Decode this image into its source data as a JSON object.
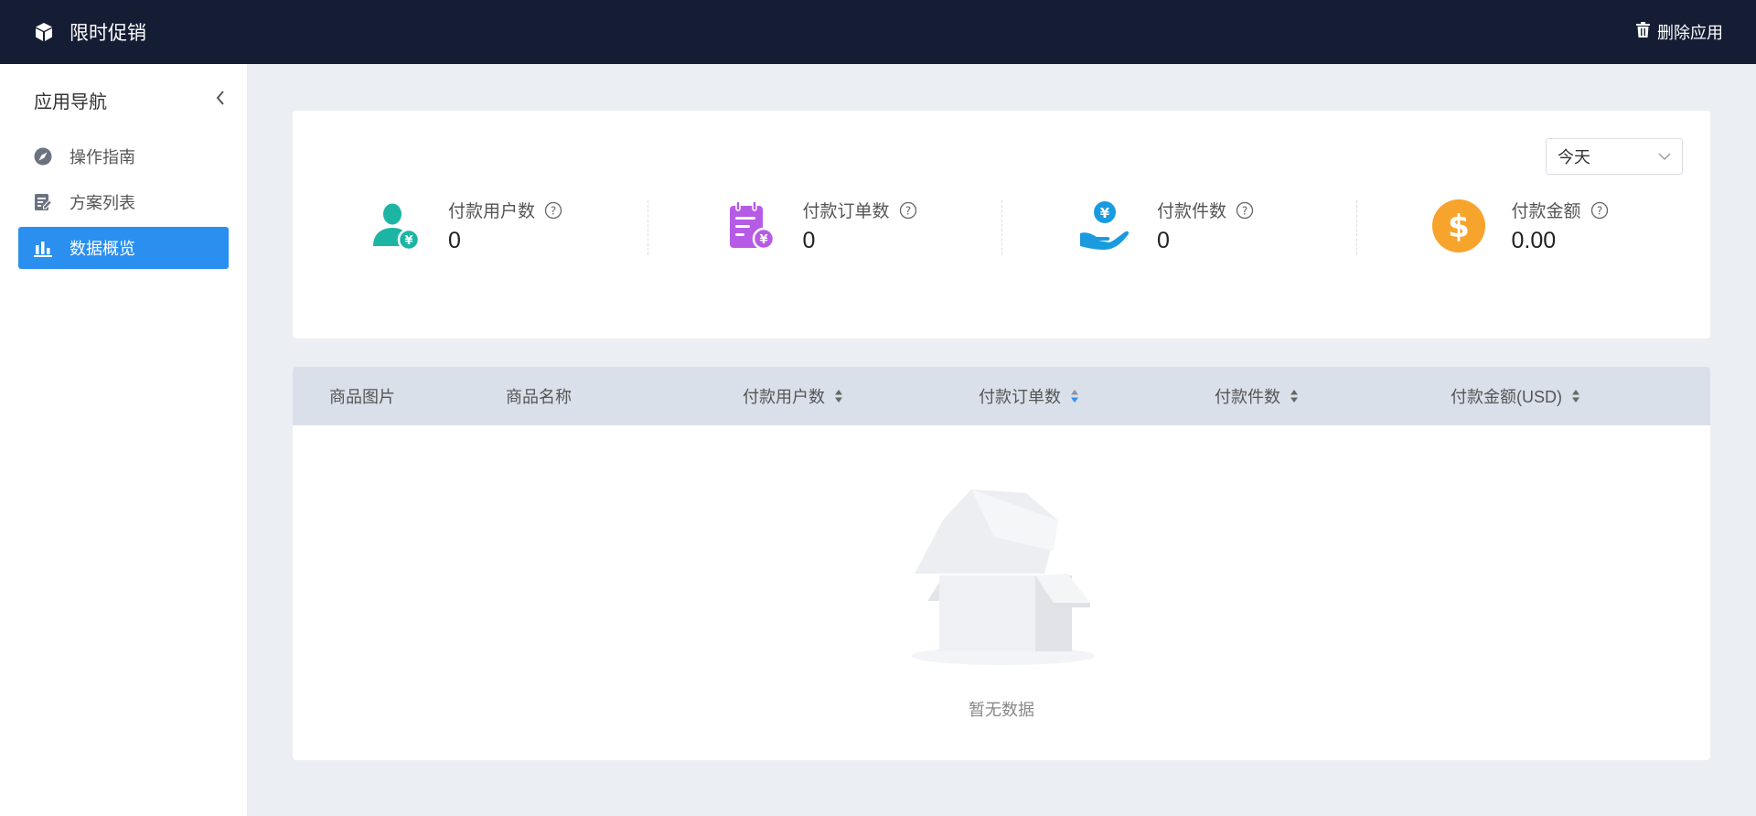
{
  "header": {
    "title": "限时促销",
    "brand_icon": "cube-icon",
    "delete_label": "删除应用",
    "delete_icon": "trash-icon"
  },
  "sidebar": {
    "title": "应用导航",
    "items": [
      {
        "label": "操作指南",
        "icon": "compass-icon",
        "active": false
      },
      {
        "label": "方案列表",
        "icon": "edit-list-icon",
        "active": false
      },
      {
        "label": "数据概览",
        "icon": "bar-chart-icon",
        "active": true
      }
    ]
  },
  "stats": {
    "range_value": "今天",
    "items": [
      {
        "label": "付款用户数",
        "value": "0",
        "icon": "user-yen-icon",
        "color": "#1cb5a3"
      },
      {
        "label": "付款订单数",
        "value": "0",
        "icon": "order-yen-icon",
        "color": "#b65be6"
      },
      {
        "label": "付款件数",
        "value": "0",
        "icon": "hand-yen-icon",
        "color": "#1a9be0"
      },
      {
        "label": "付款金额",
        "value": "0.00",
        "icon": "dollar-coin-icon",
        "color": "#f7a42d"
      }
    ]
  },
  "table": {
    "columns": [
      "商品图片",
      "商品名称",
      "付款用户数",
      "付款订单数",
      "付款件数",
      "付款金额(USD)"
    ],
    "empty_text": "暂无数据"
  },
  "colors": {
    "topbar": "#141d34",
    "accent": "#2b8ff0",
    "sort_active": "#2b8ff0"
  }
}
